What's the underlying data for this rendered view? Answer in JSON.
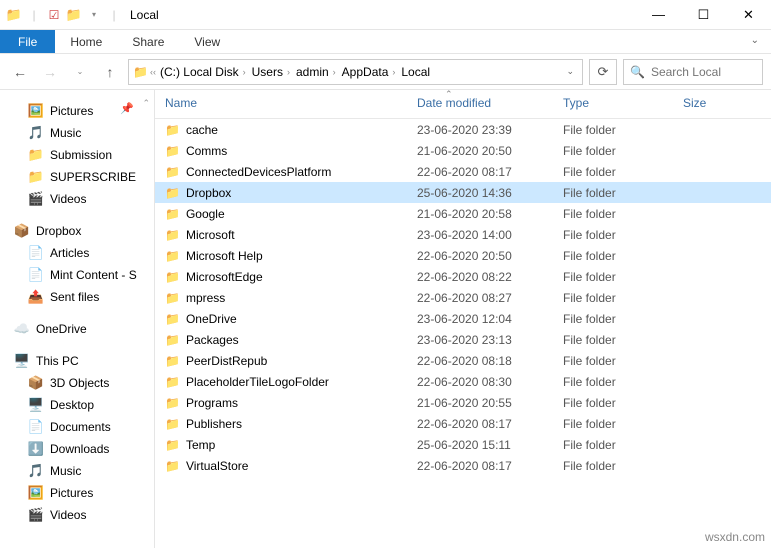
{
  "window": {
    "title": "Local"
  },
  "ribbon": {
    "file": "File",
    "home": "Home",
    "share": "Share",
    "view": "View"
  },
  "address": {
    "crumbs": [
      "(C:) Local Disk",
      "Users",
      "admin",
      "AppData",
      "Local"
    ]
  },
  "search": {
    "placeholder": "Search Local"
  },
  "sidebar": {
    "quick": [
      {
        "label": "Pictures",
        "icon": "🖼️"
      },
      {
        "label": "Music",
        "icon": "🎵"
      },
      {
        "label": "Submission",
        "icon": "📁"
      },
      {
        "label": "SUPERSCRIBE",
        "icon": "📁"
      },
      {
        "label": "Videos",
        "icon": "🎬"
      }
    ],
    "dropbox": {
      "label": "Dropbox",
      "icon": "📦"
    },
    "dropbox_items": [
      {
        "label": "Articles",
        "icon": "📄"
      },
      {
        "label": "Mint Content - S",
        "icon": "📄"
      },
      {
        "label": "Sent files",
        "icon": "📤"
      }
    ],
    "onedrive": {
      "label": "OneDrive",
      "icon": "☁️"
    },
    "thispc": {
      "label": "This PC",
      "icon": "🖥️"
    },
    "pc_items": [
      {
        "label": "3D Objects",
        "icon": "📦"
      },
      {
        "label": "Desktop",
        "icon": "🖥️"
      },
      {
        "label": "Documents",
        "icon": "📄"
      },
      {
        "label": "Downloads",
        "icon": "⬇️"
      },
      {
        "label": "Music",
        "icon": "🎵"
      },
      {
        "label": "Pictures",
        "icon": "🖼️"
      },
      {
        "label": "Videos",
        "icon": "🎬"
      }
    ]
  },
  "columns": {
    "name": "Name",
    "date": "Date modified",
    "type": "Type",
    "size": "Size"
  },
  "rows": [
    {
      "name": "cache",
      "date": "23-06-2020 23:39",
      "type": "File folder",
      "selected": false
    },
    {
      "name": "Comms",
      "date": "21-06-2020 20:50",
      "type": "File folder",
      "selected": false
    },
    {
      "name": "ConnectedDevicesPlatform",
      "date": "22-06-2020 08:17",
      "type": "File folder",
      "selected": false
    },
    {
      "name": "Dropbox",
      "date": "25-06-2020 14:36",
      "type": "File folder",
      "selected": true
    },
    {
      "name": "Google",
      "date": "21-06-2020 20:58",
      "type": "File folder",
      "selected": false
    },
    {
      "name": "Microsoft",
      "date": "23-06-2020 14:00",
      "type": "File folder",
      "selected": false
    },
    {
      "name": "Microsoft Help",
      "date": "22-06-2020 20:50",
      "type": "File folder",
      "selected": false
    },
    {
      "name": "MicrosoftEdge",
      "date": "22-06-2020 08:22",
      "type": "File folder",
      "selected": false
    },
    {
      "name": "mpress",
      "date": "22-06-2020 08:27",
      "type": "File folder",
      "selected": false
    },
    {
      "name": "OneDrive",
      "date": "23-06-2020 12:04",
      "type": "File folder",
      "selected": false
    },
    {
      "name": "Packages",
      "date": "23-06-2020 23:13",
      "type": "File folder",
      "selected": false
    },
    {
      "name": "PeerDistRepub",
      "date": "22-06-2020 08:18",
      "type": "File folder",
      "selected": false
    },
    {
      "name": "PlaceholderTileLogoFolder",
      "date": "22-06-2020 08:30",
      "type": "File folder",
      "selected": false
    },
    {
      "name": "Programs",
      "date": "21-06-2020 20:55",
      "type": "File folder",
      "selected": false
    },
    {
      "name": "Publishers",
      "date": "22-06-2020 08:17",
      "type": "File folder",
      "selected": false
    },
    {
      "name": "Temp",
      "date": "25-06-2020 15:11",
      "type": "File folder",
      "selected": false
    },
    {
      "name": "VirtualStore",
      "date": "22-06-2020 08:17",
      "type": "File folder",
      "selected": false
    }
  ],
  "watermark": "wsxdn.com"
}
